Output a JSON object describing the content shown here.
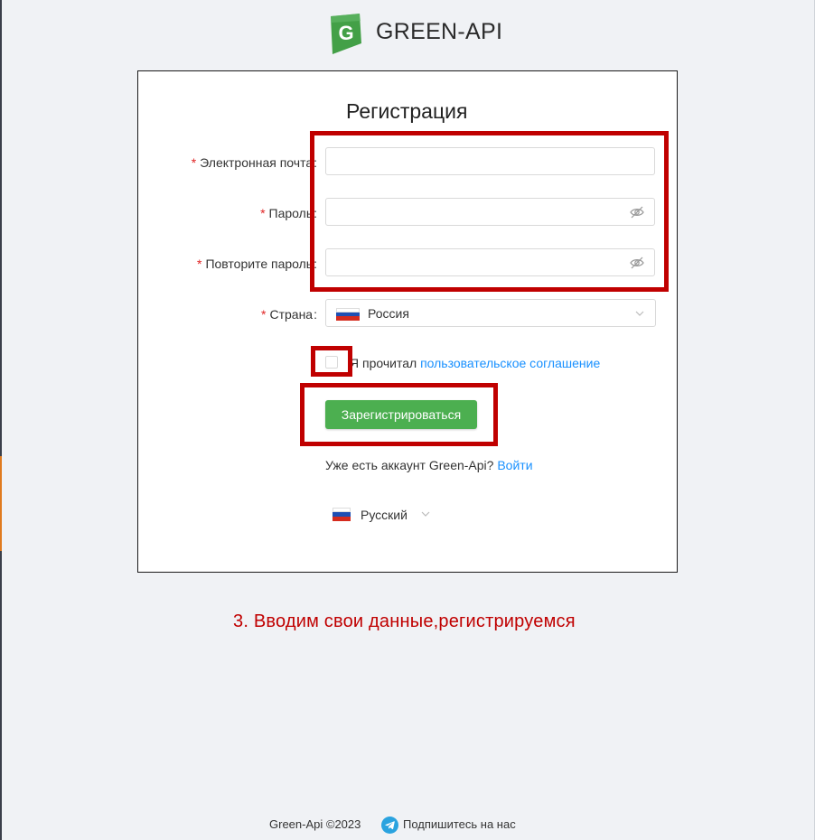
{
  "brand": {
    "name": "GREEN-API",
    "logo_letter": "G"
  },
  "form": {
    "title": "Регистрация",
    "email_label": "Электронная почта",
    "password_label": "Пароль",
    "repeat_password_label": "Повторите пароль",
    "country_label": "Страна",
    "country_value": "Россия",
    "required_mark": "*",
    "colon": ":"
  },
  "agreement": {
    "prefix": "Я прочитал",
    "link": "пользовательское соглашение"
  },
  "register_button": "Зарегистрироваться",
  "login_prompt": {
    "text": "Уже есть аккаунт Green-Api?",
    "link": "Войти"
  },
  "language": {
    "value": "Русский"
  },
  "caption": "3.  Вводим свои данные,регистрируемся",
  "footer": {
    "copyright": "Green-Api ©2023",
    "subscribe": "Подпишитесь на нас"
  },
  "icons": {
    "logo": "green-api-logo-icon",
    "eye_off": "eye-off-icon",
    "chevron": "chevron-down-icon",
    "flag": "russia-flag-icon",
    "telegram": "telegram-icon"
  },
  "colors": {
    "accent_green": "#4caf50",
    "link_blue": "#1890ff",
    "required_red": "#e02424",
    "highlight_red": "#c00000"
  }
}
